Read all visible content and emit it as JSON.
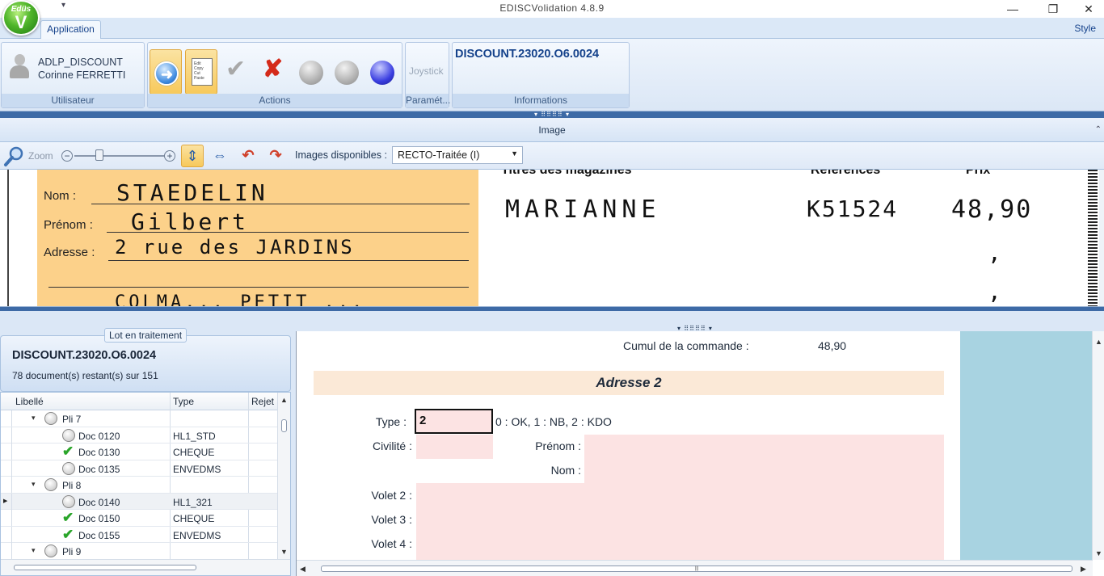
{
  "app": {
    "title": "EDISCVolidation 4.8.9",
    "logo_text": "Edüs",
    "logo_letter": "V",
    "qa_toolbar_caret": "▾",
    "window_controls": {
      "minimize": "—",
      "maximize": "❐",
      "close": "✕"
    }
  },
  "ribbon": {
    "tabs": [
      {
        "label": "Application",
        "active": true
      }
    ],
    "style_link": "Style",
    "groups": {
      "user": {
        "caption": "Utilisateur",
        "line1": "ADLP_DISCOUNT",
        "line2": "Corinne FERRETTI"
      },
      "actions": {
        "caption": "Actions"
      },
      "param": {
        "caption": "Paramét...",
        "button": "Joystick"
      },
      "info": {
        "caption": "Informations",
        "title": "DISCOUNT.23020.O6.0024"
      }
    },
    "action_icons": [
      "next-arrow-icon",
      "edit-copy-paste-icon",
      "check-icon",
      "reject-x-icon",
      "grey-ball-icon",
      "grey-ball-icon",
      "blue-ball-icon"
    ],
    "doc_icon_lines": [
      "Edit",
      "Copy",
      "Cut",
      "Paste"
    ]
  },
  "image_panel": {
    "header": "Image",
    "grip": "▾ ⠿⠿⠿⠿ ▾",
    "toolbar": {
      "zoom_label": "Zoom",
      "zoom_minus": "−",
      "zoom_plus": "+",
      "zoom_value": 0.25,
      "images_label": "Images disponibles :",
      "images_selected": "RECTO-Traitée (I)"
    }
  },
  "scan": {
    "form_labels": {
      "nom": "Nom :",
      "prenom": "Prénom :",
      "adresse": "Adresse :"
    },
    "handwriting": {
      "nom": "STAEDELIN",
      "prenom": "Gilbert",
      "adresse": "2 rue des JARDINS",
      "extra": "COLMA... PETIT ..."
    },
    "headers": {
      "titres": "Titres des magazines",
      "references": "Références",
      "prix": "Prix"
    },
    "magazine": "MARIANNE",
    "reference": "K51524",
    "price": "48,90",
    "commas": [
      ",",
      ","
    ]
  },
  "lot": {
    "caption": "Lot en traitement",
    "title": "DISCOUNT.23020.O6.0024",
    "remaining": "78 document(s) restant(s) sur 151"
  },
  "tree": {
    "columns": [
      "Libellé",
      "Type",
      "Rejet"
    ],
    "rows": [
      {
        "level": 1,
        "label": "Pli 7",
        "type": "",
        "status": "neutral",
        "expanded": true
      },
      {
        "level": 2,
        "label": "Doc 0120",
        "type": "HL1_STD",
        "status": "neutral"
      },
      {
        "level": 2,
        "label": "Doc 0130",
        "type": "CHEQUE",
        "status": "ok"
      },
      {
        "level": 2,
        "label": "Doc 0135",
        "type": "ENVEDMS",
        "status": "neutral"
      },
      {
        "level": 1,
        "label": "Pli 8",
        "type": "",
        "status": "neutral",
        "expanded": true
      },
      {
        "level": 2,
        "label": "Doc 0140",
        "type": "HL1_321",
        "status": "neutral",
        "current": true
      },
      {
        "level": 2,
        "label": "Doc 0150",
        "type": "CHEQUE",
        "status": "ok"
      },
      {
        "level": 2,
        "label": "Doc 0155",
        "type": "ENVEDMS",
        "status": "ok"
      },
      {
        "level": 1,
        "label": "Pli 9",
        "type": "",
        "status": "neutral",
        "expanded": true
      }
    ]
  },
  "form": {
    "cumul_label": "Cumul de la commande :",
    "cumul_value": "48,90",
    "section_title": "Adresse 2",
    "type_label": "Type :",
    "type_value": "2",
    "type_hint": "0 : OK, 1 : NB, 2 : KDO",
    "civilite_label": "Civilité :",
    "prenom_label": "Prénom :",
    "nom_label": "Nom :",
    "volet2_label": "Volet 2 :",
    "volet3_label": "Volet 3 :",
    "volet4_label": "Volet 4 :",
    "scroll_grip": "|||"
  }
}
